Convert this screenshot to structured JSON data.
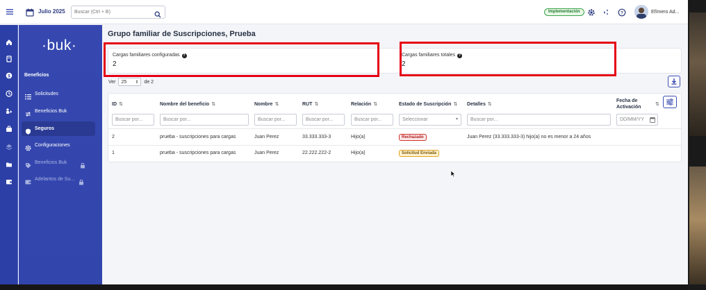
{
  "topbar": {
    "month": "Julio 2025",
    "search_placeholder": "Buscar (Ctrl + B)",
    "env_badge": "Implementación",
    "user_name": "Efímero Ad..."
  },
  "sidebar": {
    "logo": "·buk·",
    "section_title": "Beneficios",
    "items": [
      {
        "label": "Solicitudes",
        "icon": "list-icon"
      },
      {
        "label": "Beneficios Buk",
        "icon": "arrows-icon"
      },
      {
        "label": "Seguros",
        "icon": "shield-icon",
        "active": true
      },
      {
        "label": "Configuraciones",
        "icon": "gear-icon"
      },
      {
        "label": "Beneficios Buk",
        "icon": "tag-icon",
        "locked": true
      },
      {
        "label": "Adelantos de Su...",
        "icon": "wallet-icon",
        "locked": true
      }
    ]
  },
  "main": {
    "title": "Grupo familiar de Suscripciones, Prueba",
    "stats": [
      {
        "label": "Cargas familiares configuradas",
        "value": "2"
      },
      {
        "label": "Cargas familiares totales",
        "value": "2"
      }
    ],
    "pager": {
      "prefix": "Ver",
      "page_size": "25",
      "suffix": "de 2"
    },
    "table": {
      "columns": [
        {
          "label": "ID"
        },
        {
          "label": "Nombre del beneficio"
        },
        {
          "label": "Nombre"
        },
        {
          "label": "RUT"
        },
        {
          "label": "Relación"
        },
        {
          "label": "Estado de Suscripción"
        },
        {
          "label": "Detalles"
        },
        {
          "label": "Fecha de Activación"
        }
      ],
      "filters": {
        "search_placeholder": "Buscar por...",
        "select_placeholder": "Seleccionar",
        "date_placeholder": "DD/MM/YY"
      },
      "rows": [
        {
          "id": "2",
          "beneficio": "prueba - suscripciones para cargas",
          "nombre": "Juan Perez",
          "rut": "33.333.333-3",
          "relacion": "Hijo(a)",
          "estado": "Rechazado",
          "detalles": "Juan Perez (33.333.333-3) hijo(a) no es menor a 24 años"
        },
        {
          "id": "1",
          "beneficio": "prueba - suscripciones para cargas",
          "nombre": "Juan Perez",
          "rut": "22.222.222-2",
          "relacion": "Hijo(a)",
          "estado": "Solicitud Enviada",
          "detalles": ""
        }
      ]
    }
  },
  "colors": {
    "primary": "#3245ad",
    "highlight": "#e60012",
    "danger": "#d13030",
    "warning": "#e0a21f"
  }
}
